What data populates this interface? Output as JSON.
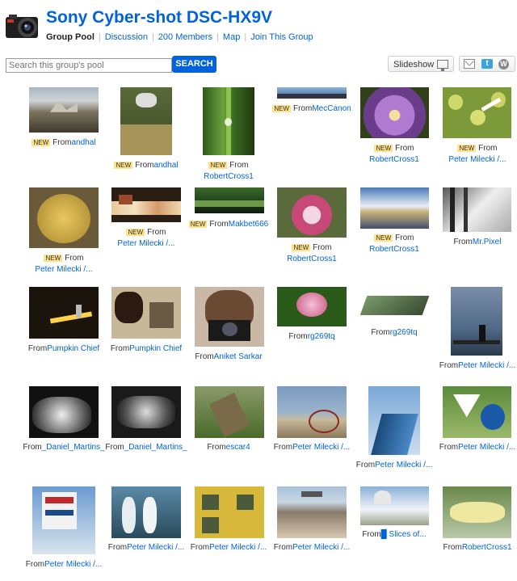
{
  "header": {
    "title": "Sony Cyber-shot DSC-HX9V",
    "nav": [
      "Group Pool",
      "Discussion",
      "200 Members",
      "Map",
      "Join This Group"
    ]
  },
  "search": {
    "placeholder": "Search this group's pool",
    "button": "SEARCH"
  },
  "toolbar": {
    "slideshow": "Slideshow",
    "share_icons": [
      "mail-icon",
      "twitter-icon",
      "wordpress-icon"
    ]
  },
  "labels": {
    "from": "From",
    "new": "NEW"
  },
  "photos": [
    {
      "author": "andhal",
      "new": true
    },
    {
      "author": "andhal",
      "new": true
    },
    {
      "author": "RobertCross1",
      "new": true
    },
    {
      "author": "MecCanon",
      "new": true
    },
    {
      "author": "RobertCross1",
      "new": true
    },
    {
      "author": "Peter Milecki /...",
      "new": true
    },
    {
      "author": "Peter Milecki /...",
      "new": true
    },
    {
      "author": "Peter Milecki /...",
      "new": true
    },
    {
      "author": "Makbet666",
      "new": true
    },
    {
      "author": "RobertCross1",
      "new": true
    },
    {
      "author": "RobertCross1",
      "new": true
    },
    {
      "author": "Mr.Pixel",
      "new": false
    },
    {
      "author": "Pumpkin Chief",
      "new": false
    },
    {
      "author": "Pumpkin Chief",
      "new": false
    },
    {
      "author": "Aniket Sarkar",
      "new": false
    },
    {
      "author": "rg269tq",
      "new": false
    },
    {
      "author": "rg269tq",
      "new": false
    },
    {
      "author": "Peter Milecki /...",
      "new": false
    },
    {
      "author": "_Daniel_Martins_",
      "new": false
    },
    {
      "author": "_Daniel_Martins_",
      "new": false
    },
    {
      "author": "escar4",
      "new": false
    },
    {
      "author": "Peter Milecki /...",
      "new": false
    },
    {
      "author": "Peter Milecki /...",
      "new": false
    },
    {
      "author": "Peter Milecki /...",
      "new": false
    },
    {
      "author": "Peter Milecki /...",
      "new": false
    },
    {
      "author": "Peter Milecki /...",
      "new": false
    },
    {
      "author": "Peter Milecki /...",
      "new": false
    },
    {
      "author": "Peter Milecki /...",
      "new": false
    },
    {
      "author": "█ Slices of...",
      "new": false
    },
    {
      "author": "RobertCross1",
      "new": false
    }
  ]
}
